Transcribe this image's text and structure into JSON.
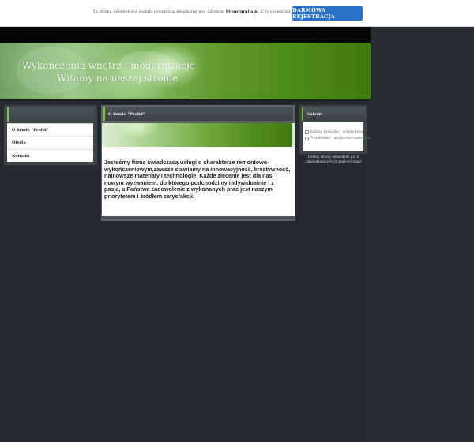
{
  "topbar": {
    "notice_prefix": "Ta strona internetowa została utworzona bezpłatnie pod adresem ",
    "notice_site": "Stronygratis.pl",
    "notice_suffix": ". Czy chcesz też mieć własną stronę?",
    "register_label": "DARMOWA REJESTRACJA"
  },
  "header": {
    "line1": "Wykończenia wnętrz i modernizacje",
    "line2": "Witamy na naszej stronie"
  },
  "menu": {
    "items": [
      {
        "label": "O firmie \"Prefid\""
      },
      {
        "label": "Oferta"
      },
      {
        "label": "Kontakt"
      }
    ]
  },
  "center": {
    "title": "O firmie \"Prefid\"",
    "body": "Jesteśmy firmą świadczącą usługi o charakterze remontowo-wykończeniowym,zawsze stawiamy na innowacyjność, kreatywność, najnowsze materiały i technologie. Każde zlecenie jest dla nas nowym wyzwaniem, do którego podchodzimy indywidualnie i z pasją, a Państwa zadowolenie z wykonanych prac jest naszym priorytetem i źródłem satysfakcji."
  },
  "gallery": {
    "title": "Galeria",
    "links": [
      {
        "label": "Kabina łazienka - ściany tetu!"
      },
      {
        "label": "Przedbłoko - akcja charcasteevna"
      }
    ]
  },
  "counter": {
    "text": "Dzisiaj stronę odwiedziło już 2 odwiedzających (2 wejście) tutaj!"
  },
  "colors": {
    "accent_green": "#7fc43a",
    "register_blue": "#2a72c9",
    "page_background": "#252a2c"
  }
}
